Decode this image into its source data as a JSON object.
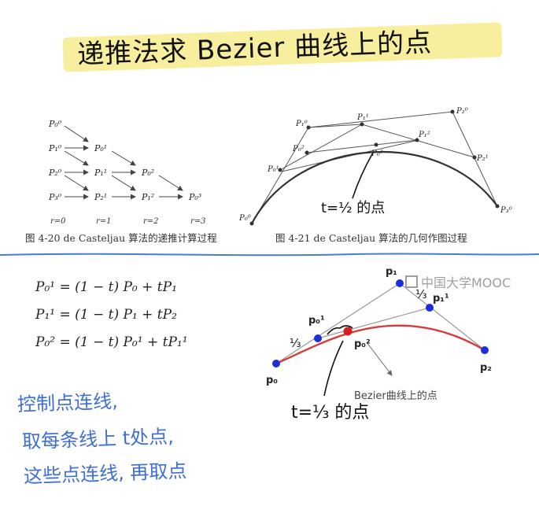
{
  "title": "递推法求 Bezier 曲线上的点",
  "top_figure": {
    "fig20_caption": "图 4-20   de Casteljau 算法的递推计算过程",
    "fig21_caption": "图 4-21   de Casteljau 算法的几何作图过程",
    "r_labels": [
      "r=0",
      "r=1",
      "r=2",
      "r=3"
    ],
    "table_points": {
      "col0": [
        "P₀⁰",
        "P₁⁰",
        "P₂⁰",
        "P₃⁰"
      ],
      "col1": [
        "P₀¹",
        "P₁¹",
        "P₂¹"
      ],
      "col2": [
        "P₀²",
        "P₁²"
      ],
      "col3": [
        "P₀³"
      ]
    },
    "geo_labels": [
      "P₀⁰",
      "P₁⁰",
      "P₂⁰",
      "P₃⁰",
      "P₀¹",
      "P₁¹",
      "P₂¹",
      "P₀²",
      "P₁²",
      "P₀³"
    ],
    "annotation": "t=½ 的点"
  },
  "equations": [
    "P₀¹  =  (1 − t) P₀  +  tP₁",
    "P₁¹  =  (1 − t) P₁  +  tP₂",
    "P₀²  =  (1 − t) P₀¹  +  tP₁¹"
  ],
  "bottom_figure": {
    "watermark": "中国大学MOOC",
    "labels": {
      "p0": "p₀",
      "p1": "p₁",
      "p2": "p₂",
      "p01": "p₀¹",
      "p11": "p₁¹",
      "p02": "p₀²"
    },
    "fraction_marks": [
      "⅓",
      "⅓"
    ],
    "curve_caption": "Bezier曲线上的点",
    "annotation": "t=⅓ 的点",
    "colors": {
      "curve": "#d93b3b",
      "control_point": "#1c2fd6",
      "result_point": "#d61f1f",
      "polygon": "#9a9a9a"
    }
  },
  "notes": [
    "控制点连线,",
    "取每条线上 t处点,",
    "这些点连线, 再取点"
  ]
}
